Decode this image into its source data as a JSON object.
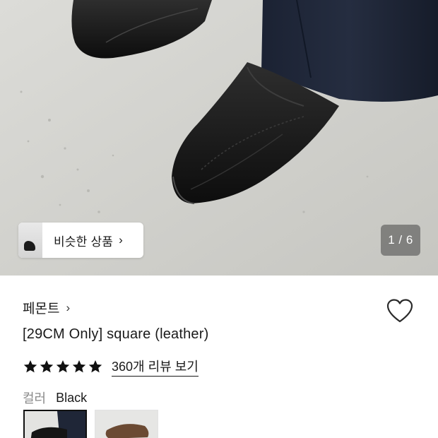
{
  "hero": {
    "similar_button_label": "비슷한 상품",
    "similar_chevron": "›",
    "page_counter": "1 / 6"
  },
  "product": {
    "brand": "페몬트",
    "brand_chevron": "›",
    "title": "[29CM Only] square (leather)",
    "rating_stars": 5,
    "review_link": "360개 리뷰 보기",
    "color_label": "컬러",
    "color_value": "Black"
  },
  "swatches": [
    {
      "color": "#1c1c1c",
      "selected": true
    },
    {
      "color": "#6b4a33",
      "selected": false
    }
  ],
  "icons": {
    "wish": "heart-outline-icon",
    "star": "star-filled-icon",
    "chevron": "chevron-right-icon"
  }
}
